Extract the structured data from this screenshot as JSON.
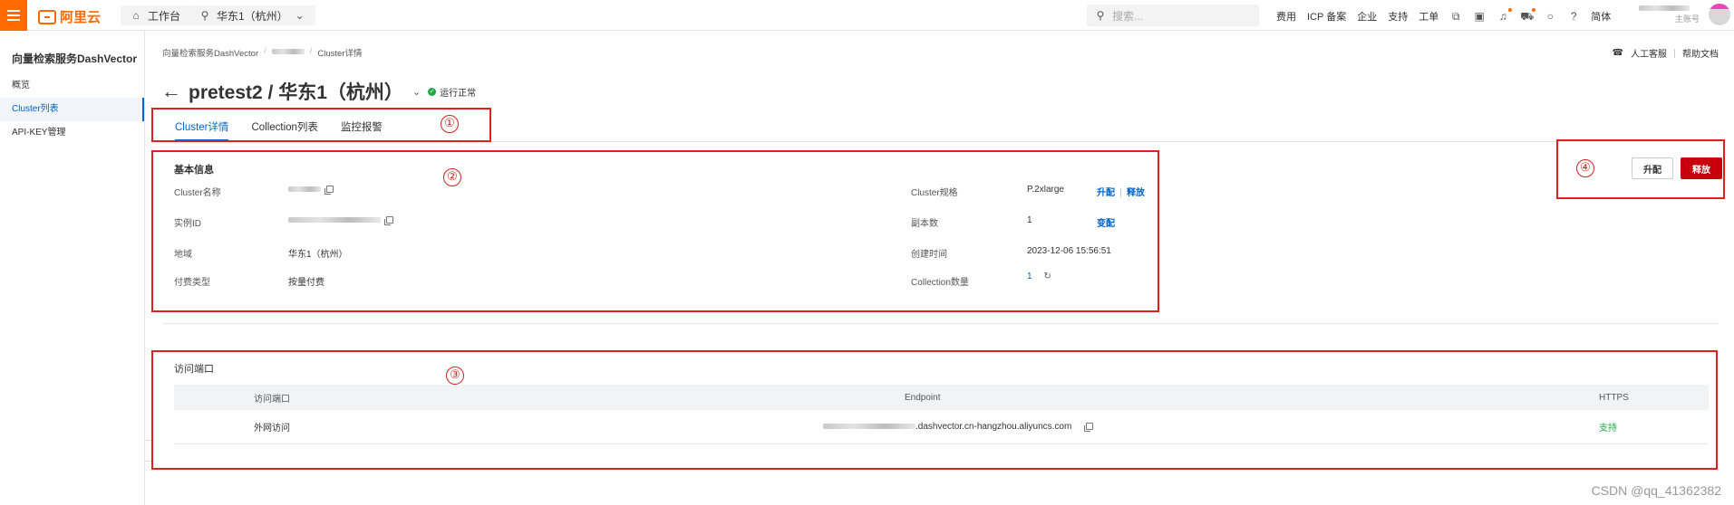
{
  "topbar": {
    "logo_text": "阿里云",
    "workbench_label": "工作台",
    "region_label": "华东1（杭州）",
    "search_placeholder": "搜索...",
    "links": [
      "费用",
      "ICP 备案",
      "企业",
      "支持",
      "工单"
    ],
    "lang_label": "简体",
    "account_role": "主账号"
  },
  "sidebar": {
    "title": "向量检索服务DashVector",
    "items": [
      {
        "label": "概览",
        "active": false
      },
      {
        "label": "Cluster列表",
        "active": true
      },
      {
        "label": "API-KEY管理",
        "active": false
      }
    ]
  },
  "breadcrumb": {
    "root": "向量检索服务DashVector",
    "current": "Cluster详情"
  },
  "header_links": {
    "service": "人工客服",
    "help": "帮助文档"
  },
  "page": {
    "title": "pretest2 / 华东1（杭州）",
    "status": "运行正常",
    "status_color": "#1ea843"
  },
  "tabs": [
    {
      "label": "Cluster详情",
      "active": true
    },
    {
      "label": "Collection列表",
      "active": false
    },
    {
      "label": "监控报警",
      "active": false
    }
  ],
  "annotations": [
    "①",
    "②",
    "③",
    "④"
  ],
  "basic_info": {
    "section_title": "基本信息",
    "cluster_name_label": "Cluster名称",
    "instance_id_label": "实例ID",
    "region_label": "地域",
    "region_value": "华东1（杭州）",
    "billing_label": "付费类型",
    "billing_value": "按量付费",
    "spec_label": "Cluster规格",
    "spec_value": "P.2xlarge",
    "spec_upgrade": "升配",
    "spec_release": "释放",
    "replicas_label": "副本数",
    "replicas_value": "1",
    "replicas_change": "变配",
    "created_label": "创建时间",
    "created_value": "2023-12-06 15:56:51",
    "collection_count_label": "Collection数量",
    "collection_count_value": "1"
  },
  "access": {
    "section_title": "访问端口",
    "columns": [
      "访问端口",
      "Endpoint",
      "HTTPS"
    ],
    "rows": [
      {
        "port": "外网访问",
        "endpoint_suffix": ".dashvector.cn-hangzhou.aliyuncs.com",
        "https": "支持"
      }
    ]
  },
  "actions": {
    "upgrade": "升配",
    "release": "释放"
  },
  "colors": {
    "accent": "#0064c8",
    "brand": "#ff6a00",
    "danger": "#c7000b",
    "annotation": "#e0201f",
    "success": "#1ea843"
  },
  "watermark": "CSDN @qq_41362382"
}
